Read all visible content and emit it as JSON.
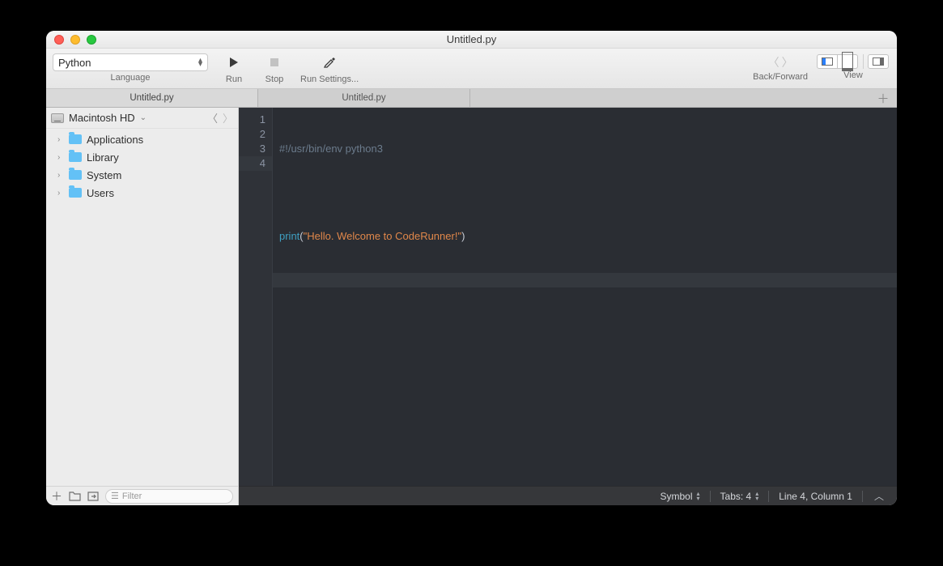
{
  "window": {
    "title": "Untitled.py"
  },
  "toolbar": {
    "language_selected": "Python",
    "language_label": "Language",
    "run_label": "Run",
    "stop_label": "Stop",
    "runsettings_label": "Run Settings...",
    "backforward_label": "Back/Forward",
    "view_label": "View"
  },
  "tabs": [
    {
      "label": "Untitled.py",
      "active": true
    },
    {
      "label": "Untitled.py",
      "active": false
    }
  ],
  "sidebar": {
    "root_name": "Macintosh HD",
    "items": [
      {
        "label": "Applications"
      },
      {
        "label": "Library"
      },
      {
        "label": "System"
      },
      {
        "label": "Users"
      }
    ],
    "filter_placeholder": "Filter"
  },
  "editor": {
    "lines": [
      {
        "n": "1",
        "type": "comment",
        "text": "#!/usr/bin/env python3"
      },
      {
        "n": "2",
        "type": "blank",
        "text": ""
      },
      {
        "n": "3",
        "type": "print",
        "func": "print",
        "open": "(",
        "str": "\"Hello. Welcome to CodeRunner!\"",
        "close": ")"
      },
      {
        "n": "4",
        "type": "current",
        "text": ""
      }
    ]
  },
  "status": {
    "symbol_label": "Symbol",
    "tabs_label": "Tabs: 4",
    "pos_label": "Line 4, Column 1"
  }
}
